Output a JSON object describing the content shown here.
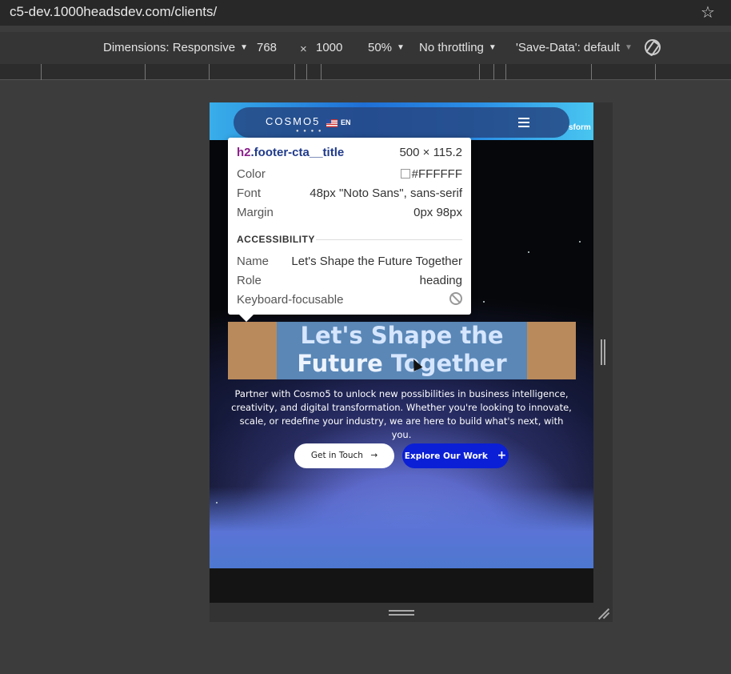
{
  "browser": {
    "url": "c5-dev.1000headsdev.com/clients/",
    "bookmark_icon": "star-icon"
  },
  "device_toolbar": {
    "dimensions_label": "Dimensions: Responsive",
    "width": "768",
    "times": "×",
    "height": "1000",
    "zoom": "50%",
    "throttling": "No throttling",
    "save_data": "'Save-Data': default",
    "rotate_icon": "rotate-icon"
  },
  "site": {
    "logo": "COSMO5",
    "logo_dots": "● ● ● ●",
    "language": "EN",
    "nav_peek": "sform",
    "cta_title_line1": "Let's Shape the",
    "cta_title_bold": "Future",
    "cta_title_rest": "Together",
    "cta_description": "Partner with Cosmo5 to unlock new possibilities in business intelligence, creativity, and digital transformation. Whether you're looking to innovate, scale, or redefine your industry, we are here to build what's next, with you.",
    "btn_touch": "Get in Touch",
    "btn_touch_arrow": "→",
    "btn_explore": "Explore Our Work",
    "btn_explore_plus": "+"
  },
  "inspect_tooltip": {
    "tag": "h2",
    "class": ".footer-cta__title",
    "size": "500 × 115.2",
    "color_label": "Color",
    "color_value": "#FFFFFF",
    "font_label": "Font",
    "font_value": "48px \"Noto Sans\", sans-serif",
    "margin_label": "Margin",
    "margin_value": "0px 98px",
    "section_label": "ACCESSIBILITY",
    "name_label": "Name",
    "name_value": "Let's Shape the Future Together",
    "role_label": "Role",
    "role_value": "heading",
    "focus_label": "Keyboard-focusable"
  }
}
